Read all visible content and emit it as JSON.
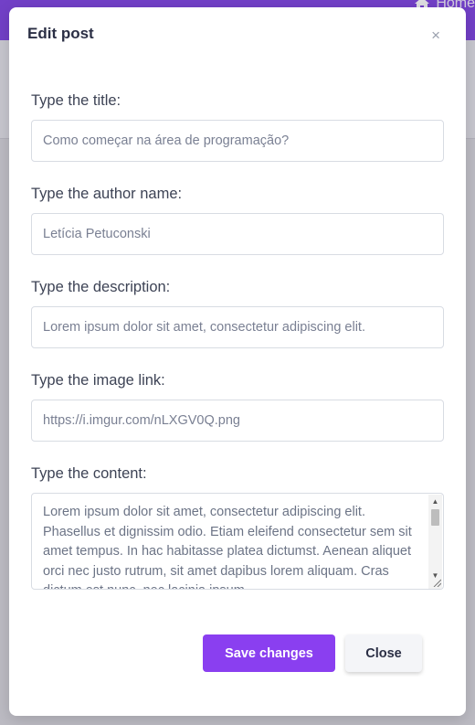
{
  "background": {
    "nav_label": "Home"
  },
  "modal": {
    "title": "Edit post",
    "close_symbol": "×",
    "fields": [
      {
        "label": "Type the title:",
        "value": "Como começar na área de programação?"
      },
      {
        "label": "Type the author name:",
        "value": "Letícia Petuconski"
      },
      {
        "label": "Type the description:",
        "value": "Lorem ipsum dolor sit amet, consectetur adipiscing elit."
      },
      {
        "label": "Type the image link:",
        "value": "https://i.imgur.com/nLXGV0Q.png"
      }
    ],
    "content": {
      "label": "Type the content:",
      "value": "Lorem ipsum dolor sit amet, consectetur adipiscing elit. Phasellus et dignissim odio. Etiam eleifend consectetur sem sit amet tempus. In hac habitasse platea dictumst. Aenean aliquet orci nec justo rutrum, sit amet dapibus lorem aliquam. Cras dictum est nunc, nec lacinia ipsum."
    },
    "buttons": {
      "save": "Save changes",
      "close": "Close"
    }
  },
  "colors": {
    "header": "#7c3fe0",
    "primary_button": "#8a3ff0"
  }
}
